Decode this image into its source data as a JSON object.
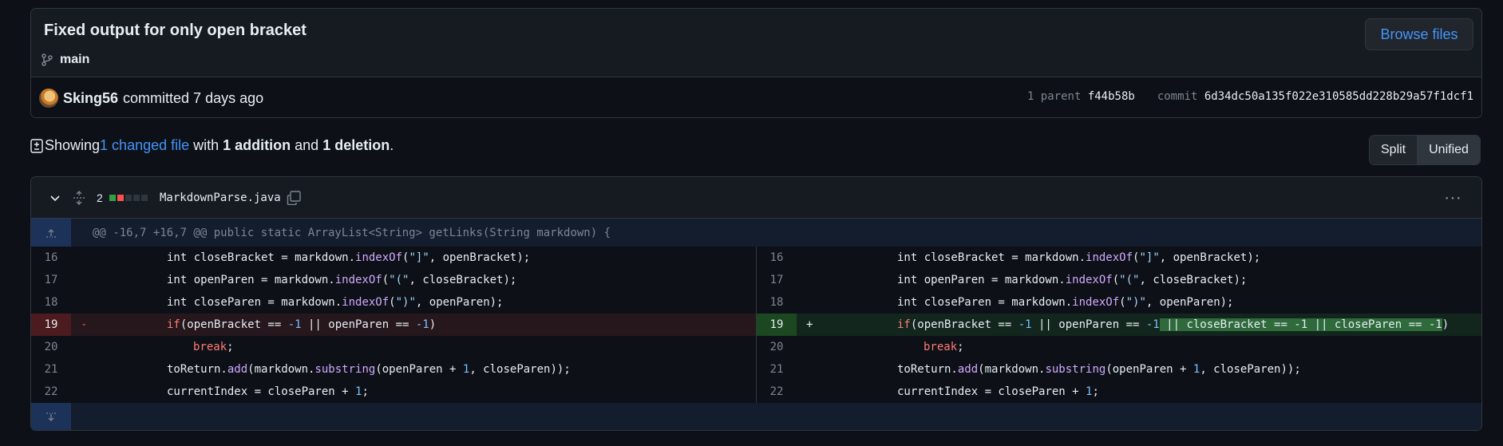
{
  "commit": {
    "title": "Fixed output for only open bracket",
    "branch": "main",
    "browse_label": "Browse files",
    "author": "Sking56",
    "action_text": "committed 7 days ago",
    "parent_label": "1 parent",
    "parent_hash": "f44b58b",
    "commit_label": "commit",
    "commit_hash": "6d34dc50a135f022e310585dd228b29a57f1dcf1"
  },
  "stats": {
    "prefix": "Showing ",
    "changed_files": "1 changed file",
    "with": " with ",
    "additions": "1 addition",
    "and": " and ",
    "deletions": "1 deletion",
    "suffix": "."
  },
  "view_toggle": {
    "split": "Split",
    "unified": "Unified"
  },
  "file": {
    "change_count": "2",
    "name": "MarkdownParse.java",
    "diffstat_colors": [
      "#2ea043",
      "#f85149",
      "#30363d",
      "#30363d",
      "#30363d"
    ],
    "hunk_header": "@@ -16,7 +16,7 @@ public static ArrayList<String> getLinks(String markdown) {"
  },
  "icons": {
    "branch": "git-branch-icon",
    "file_diff": "file-diff-icon",
    "chevron": "chevron-down-icon",
    "expand": "unfold-icon",
    "copy": "copy-icon",
    "kebab": "kebab-horizontal-icon",
    "expand_up": "expand-up-icon",
    "expand_down": "expand-down-icon"
  },
  "colors": {
    "link": "#4493f8",
    "deleted_line": "#25171c",
    "added_line": "#12261e",
    "hunk_bg": "#131d2e"
  },
  "diff": {
    "left_numbers": [
      "16",
      "17",
      "18",
      "19",
      "20",
      "21",
      "22"
    ],
    "right_numbers": [
      "16",
      "17",
      "18",
      "19",
      "20",
      "21",
      "22"
    ],
    "del_sign": "-",
    "add_sign": "+",
    "lines": [
      "int closeBracket = markdown.indexOf(\"]\", openBracket);",
      "int openParen = markdown.indexOf(\"(\", closeBracket);",
      "int closeParen = markdown.indexOf(\")\", openParen);",
      "if(openBracket == -1 || openParen == -1)",
      "break;",
      "toReturn.add(markdown.substring(openParen + 1, closeParen));",
      "currentIndex = closeParen + 1;"
    ],
    "added_line": "if(openBracket == -1 || openParen == -1 || closeBracket == -1 || closeParen == -1)"
  }
}
